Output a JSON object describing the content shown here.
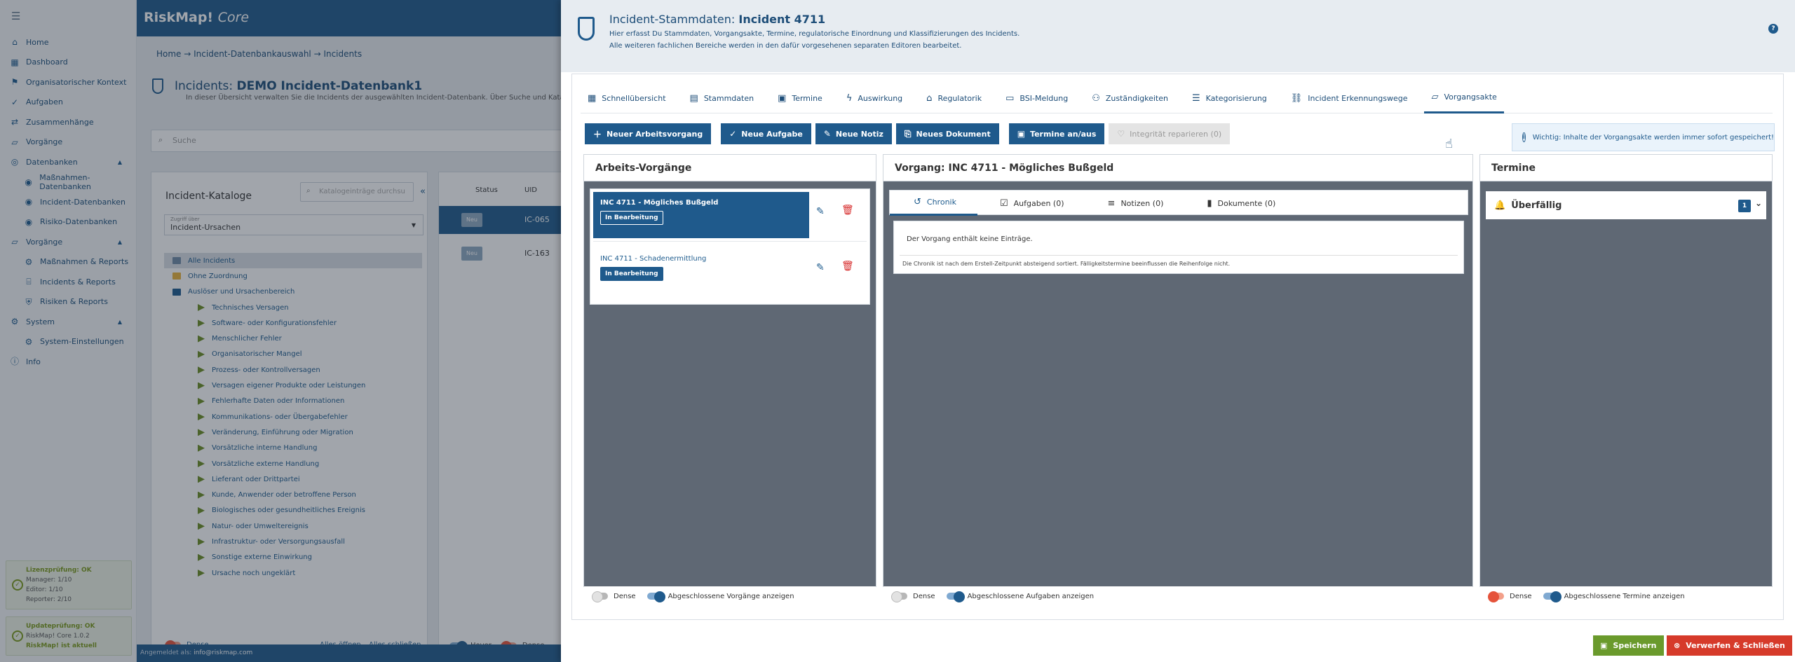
{
  "app": {
    "brand": "RiskMap!",
    "brand_suffix": "Core",
    "menu_icon": "menu-icon"
  },
  "sidebar": {
    "items": [
      {
        "label": "Home",
        "icon": "home-icon",
        "level": 0
      },
      {
        "label": "Dashboard",
        "icon": "dashboard-icon",
        "level": 0
      },
      {
        "label": "Organisatorischer Kontext",
        "icon": "org-icon",
        "level": 0
      },
      {
        "label": "Aufgaben",
        "icon": "tasks-icon",
        "level": 0
      },
      {
        "label": "Zusammenhänge",
        "icon": "relations-icon",
        "level": 0
      },
      {
        "label": "Vorgänge",
        "icon": "folder-icon",
        "level": 0
      },
      {
        "label": "Datenbanken",
        "icon": "database-icon",
        "level": 0,
        "group": true
      },
      {
        "label": "Maßnahmen-Datenbanken",
        "icon": "db-measures-icon",
        "level": 1
      },
      {
        "label": "Incident-Datenbanken",
        "icon": "db-incident-icon",
        "level": 1
      },
      {
        "label": "Risiko-Datenbanken",
        "icon": "db-risk-icon",
        "level": 1
      },
      {
        "label": "Vorgänge",
        "icon": "folder-icon",
        "level": 0,
        "group": true
      },
      {
        "label": "Maßnahmen & Reports",
        "icon": "measures-icon",
        "level": 1
      },
      {
        "label": "Incidents & Reports",
        "icon": "incident-icon",
        "level": 1
      },
      {
        "label": "Risiken & Reports",
        "icon": "risk-icon",
        "level": 1
      },
      {
        "label": "System",
        "icon": "gear-icon",
        "level": 0,
        "group": true
      },
      {
        "label": "System-Einstellungen",
        "icon": "settings-icon",
        "level": 1
      },
      {
        "label": "Info",
        "icon": "info-icon",
        "level": 0
      }
    ],
    "license": {
      "title": "Lizenzprüfung: OK",
      "l1": "Manager: 1/10",
      "l2": "Editor: 1/10",
      "l3": "Reporter: 2/10"
    },
    "update": {
      "title": "Updateprüfung: OK",
      "l1": "RiskMap! Core 1.0.2",
      "l2": "RiskMap! ist aktuell"
    }
  },
  "bg": {
    "crumb": "Home  →  Incident-Datenbankauswahl  →  Incidents",
    "title_prefix": "Incidents:",
    "title_name": "DEMO Incident-Datenbank1",
    "subtitle": "In dieser Übersicht verwalten Sie die Incidents der ausgewählten Incident-Datenbank. Über Suche und Katalogfi",
    "search_placeholder": "Suche",
    "catalog_title": "Incident-Kataloge",
    "catalog_search": "Katalogeinträge durchsu",
    "select_caption": "Zugriff über",
    "select_value": "Incident-Ursachen",
    "tree": [
      {
        "label": "Alle Incidents",
        "kind": "sel"
      },
      {
        "label": "Ohne Zuordnung",
        "kind": "folder"
      },
      {
        "label": "Auslöser und Ursachenbereich",
        "kind": "root"
      },
      {
        "label": "Technisches Versagen",
        "kind": "leaf"
      },
      {
        "label": "Software- oder Konfigurationsfehler",
        "kind": "leaf"
      },
      {
        "label": "Menschlicher Fehler",
        "kind": "leaf"
      },
      {
        "label": "Organisatorischer Mangel",
        "kind": "leaf"
      },
      {
        "label": "Prozess- oder Kontrollversagen",
        "kind": "leaf"
      },
      {
        "label": "Versagen eigener Produkte oder Leistungen",
        "kind": "leaf"
      },
      {
        "label": "Fehlerhafte Daten oder Informationen",
        "kind": "leaf"
      },
      {
        "label": "Kommunikations- oder Übergabefehler",
        "kind": "leaf"
      },
      {
        "label": "Veränderung, Einführung oder Migration",
        "kind": "leaf"
      },
      {
        "label": "Vorsätzliche interne Handlung",
        "kind": "leaf"
      },
      {
        "label": "Vorsätzliche externe Handlung",
        "kind": "leaf"
      },
      {
        "label": "Lieferant oder Drittpartei",
        "kind": "leaf"
      },
      {
        "label": "Kunde, Anwender oder betroffene Person",
        "kind": "leaf"
      },
      {
        "label": "Biologisches oder gesundheitliches Ereignis",
        "kind": "leaf"
      },
      {
        "label": "Natur- oder Umweltereignis",
        "kind": "leaf"
      },
      {
        "label": "Infrastruktur- oder Versorgungsausfall",
        "kind": "leaf"
      },
      {
        "label": "Sonstige externe Einwirkung",
        "kind": "leaf"
      },
      {
        "label": "Ursache noch ungeklärt",
        "kind": "leaf"
      }
    ],
    "dense": "Dense",
    "open_all": "Alles öffnen",
    "close_all": "Alles schließen",
    "col_status": "Status",
    "col_uid": "UID",
    "row1_uid": "IC-065",
    "row2_uid": "IC-163",
    "badge_new": "Neu",
    "hover": "Hover",
    "dense2": "Dense",
    "status_prefix": "Angemeldet als:",
    "status_user": "info@riskmap.com"
  },
  "dialog": {
    "title_prefix": "Incident-Stammdaten:",
    "title_name": "Incident 4711",
    "sub1": "Hier erfasst Du Stammdaten, Vorgangsakte, Termine, regulatorische Einordnung und Klassifizierungen des Incidents.",
    "sub2": "Alle weiteren fachlichen Bereiche werden in den dafür vorgesehenen separaten Editoren bearbeitet.",
    "help": "?",
    "tabs": [
      {
        "label": "Schnellübersicht",
        "icon": "overview-icon",
        "glyph": "▦"
      },
      {
        "label": "Stammdaten",
        "icon": "document-icon",
        "glyph": "▤"
      },
      {
        "label": "Termine",
        "icon": "calendar-icon",
        "glyph": "▣"
      },
      {
        "label": "Auswirkung",
        "icon": "lightning-icon",
        "glyph": "ϟ"
      },
      {
        "label": "Regulatorik",
        "icon": "bank-icon",
        "glyph": "⌂"
      },
      {
        "label": "BSI-Meldung",
        "icon": "report-icon",
        "glyph": "▭"
      },
      {
        "label": "Zuständigkeiten",
        "icon": "people-icon",
        "glyph": "⚇"
      },
      {
        "label": "Kategorisierung",
        "icon": "checklist-icon",
        "glyph": "☰"
      },
      {
        "label": "Incident Erkennungswege",
        "icon": "network-icon",
        "glyph": "⛓"
      },
      {
        "label": "Vorgangsakte",
        "icon": "folder-icon",
        "glyph": "▱",
        "active": true
      }
    ],
    "actions": [
      {
        "label": "Neuer Arbeitsvorgang",
        "icon": "new-process-icon",
        "glyph": "＋"
      },
      {
        "label": "Neue Aufgabe",
        "icon": "new-task-icon",
        "glyph": "✓"
      },
      {
        "label": "Neue Notiz",
        "icon": "new-note-icon",
        "glyph": "✎"
      },
      {
        "label": "Neues Dokument",
        "icon": "attachment-icon",
        "glyph": "⎘"
      },
      {
        "label": "Termine an/aus",
        "icon": "calendar-icon",
        "glyph": "▣"
      },
      {
        "label": "Integrität reparieren (0)",
        "icon": "heart-icon",
        "glyph": "♡",
        "disabled": true
      }
    ],
    "info": "Wichtig: Inhalte der Vorgangsakte werden immer sofort gespeichert!",
    "info_icon": "i",
    "p1": {
      "title": "Arbeits-Vorgänge",
      "items": [
        {
          "title": "INC 4711 - Mögliches Bußgeld",
          "status": "In Bearbeitung",
          "active": true
        },
        {
          "title": "INC 4711 - Schadenermittlung",
          "status": "In Bearbeitung",
          "active": false
        }
      ],
      "dense": "Dense",
      "toggle": "Abgeschlossene Vorgänge anzeigen"
    },
    "p2": {
      "title": "Vorgang: INC 4711 - Mögliches Bußgeld",
      "tabs": [
        {
          "label": "Chronik",
          "icon": "history-icon",
          "glyph": "↺",
          "active": true
        },
        {
          "label": "Aufgaben (0)",
          "icon": "checklist-icon",
          "glyph": "☑"
        },
        {
          "label": "Notizen (0)",
          "icon": "notes-icon",
          "glyph": "≡"
        },
        {
          "label": "Dokumente (0)",
          "icon": "file-icon",
          "glyph": "▮"
        }
      ],
      "empty": "Der Vorgang enthält keine Einträge.",
      "note": "Die Chronik ist nach dem Erstell-Zeitpunkt absteigend sortiert. Fälligkeitstermine beeinflussen die Reihenfolge nicht.",
      "dense": "Dense",
      "toggle": "Abgeschlossene Aufgaben anzeigen"
    },
    "p3": {
      "title": "Termine",
      "row": "Überfällig",
      "count": "1",
      "dense": "Dense",
      "toggle": "Abgeschlossene Termine anzeigen"
    },
    "save": "Speichern",
    "discard": "Verwerfen & Schließen"
  }
}
